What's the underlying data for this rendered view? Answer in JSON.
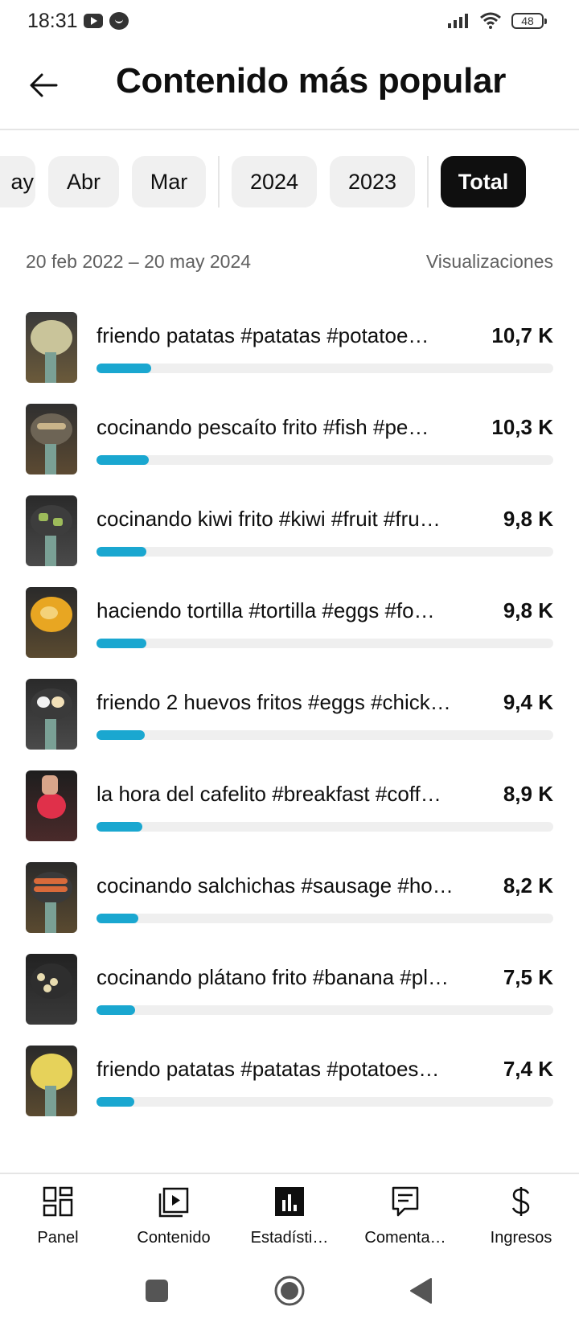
{
  "status_bar": {
    "time": "18:31",
    "battery": "48"
  },
  "header": {
    "title": "Contenido más popular"
  },
  "filters": {
    "chips": [
      {
        "label": "ay",
        "active": false
      },
      {
        "label": "Abr",
        "active": false
      },
      {
        "label": "Mar",
        "active": false
      },
      {
        "label": "2024",
        "active": false
      },
      {
        "label": "2023",
        "active": false
      },
      {
        "label": "Total",
        "active": true
      }
    ]
  },
  "summary": {
    "date_range": "20 feb 2022 – 20 may 2024",
    "metric": "Visualizaciones"
  },
  "items": [
    {
      "title": "friendo patatas #patatas #potatoe…",
      "value": "10,7 K",
      "views": 10700
    },
    {
      "title": "cocinando pescaíto frito #fish #pe…",
      "value": "10,3 K",
      "views": 10300
    },
    {
      "title": "cocinando kiwi frito #kiwi #fruit #fru…",
      "value": "9,8 K",
      "views": 9800
    },
    {
      "title": "haciendo tortilla #tortilla #eggs #fo…",
      "value": "9,8 K",
      "views": 9800
    },
    {
      "title": "friendo 2 huevos fritos #eggs #chick…",
      "value": "9,4 K",
      "views": 9400
    },
    {
      "title": "la hora del cafelito #breakfast #coff…",
      "value": "8,9 K",
      "views": 8900
    },
    {
      "title": "cocinando salchichas #sausage #ho…",
      "value": "8,2 K",
      "views": 8200
    },
    {
      "title": "cocinando plátano frito #banana #pl…",
      "value": "7,5 K",
      "views": 7500
    },
    {
      "title": "friendo patatas #patatas #potatoes…",
      "value": "7,4 K",
      "views": 7400
    }
  ],
  "bar_fill_fraction": [
    0.12,
    0.115,
    0.11,
    0.109,
    0.105,
    0.1,
    0.092,
    0.084,
    0.082
  ],
  "accent_color": "#1aa7d0",
  "bottom_nav": [
    {
      "label": "Panel",
      "icon": "dashboard-icon"
    },
    {
      "label": "Contenido",
      "icon": "content-icon"
    },
    {
      "label": "Estadísti…",
      "icon": "analytics-icon"
    },
    {
      "label": "Comenta…",
      "icon": "comments-icon"
    },
    {
      "label": "Ingresos",
      "icon": "dollar-icon"
    }
  ]
}
